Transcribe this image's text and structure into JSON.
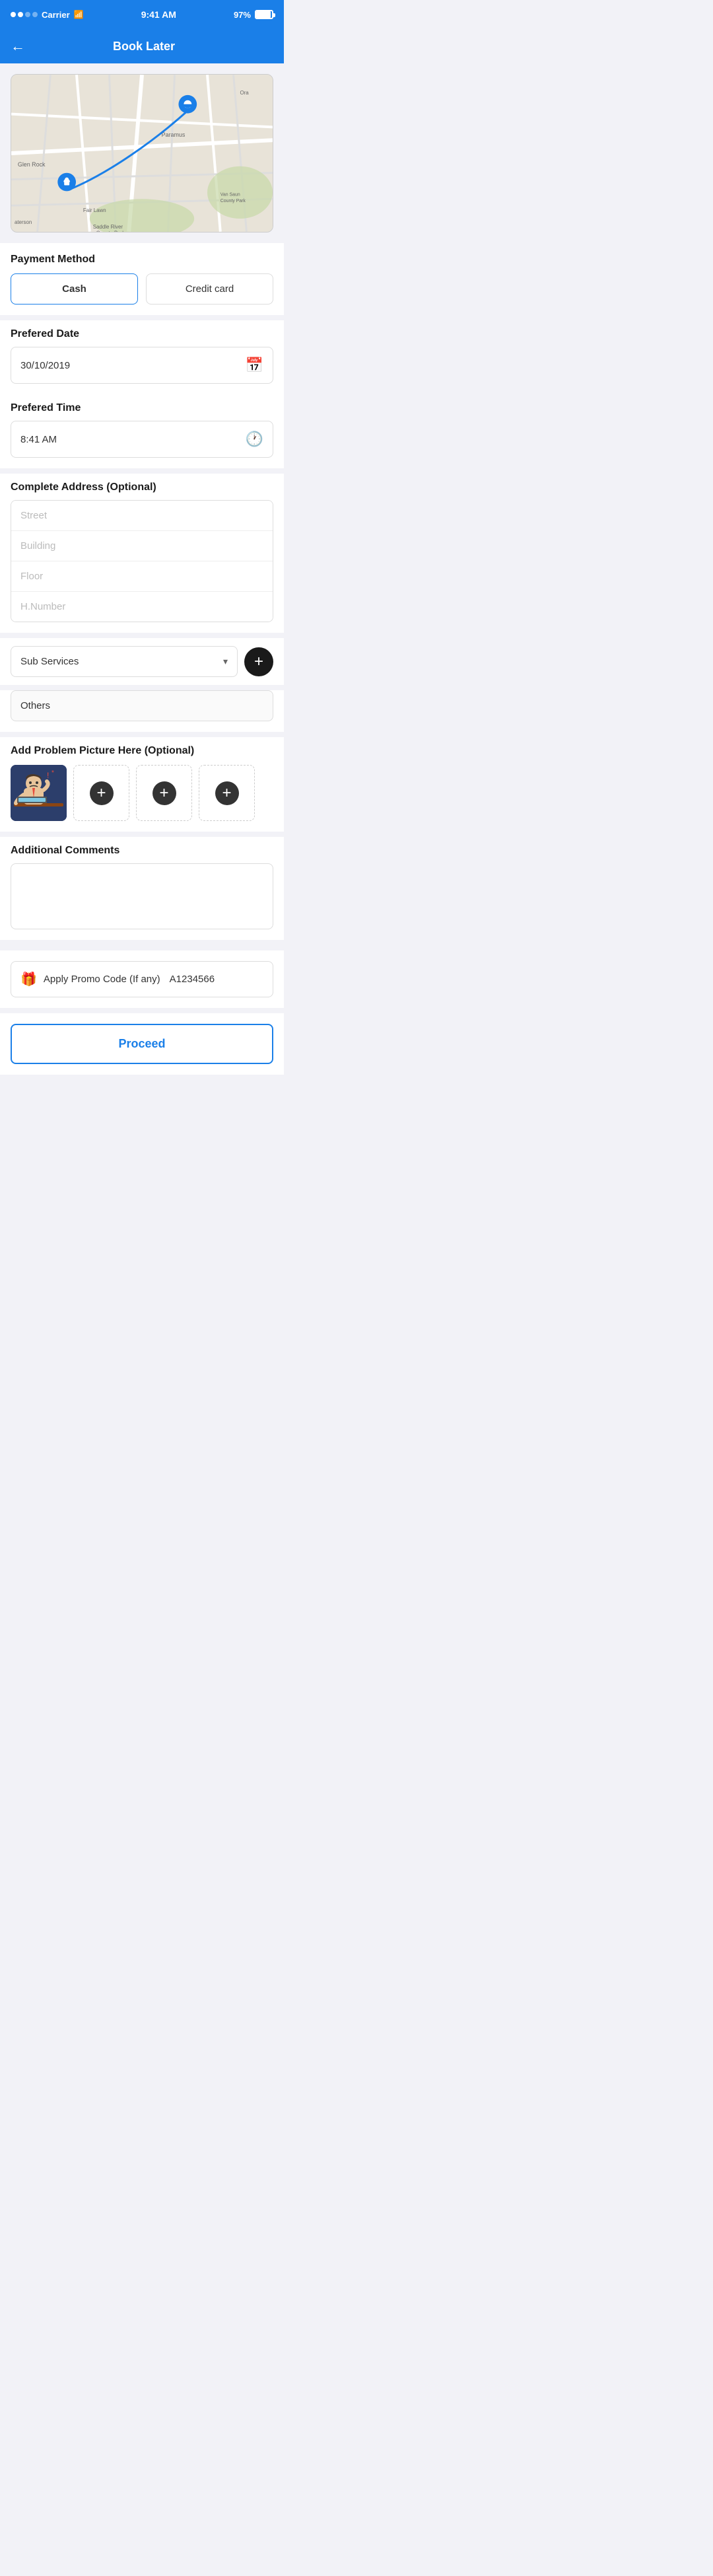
{
  "statusBar": {
    "carrier": "Carrier",
    "time": "9:41 AM",
    "battery": "97%"
  },
  "navBar": {
    "title": "Book Later",
    "backLabel": "←"
  },
  "paymentMethod": {
    "title": "Payment Method",
    "cash": "Cash",
    "creditCard": "Credit card"
  },
  "preferredDate": {
    "label": "Prefered Date",
    "value": "30/10/2019"
  },
  "preferredTime": {
    "label": "Prefered Time",
    "value": "8:41 AM"
  },
  "completeAddress": {
    "title": "Complete Address (Optional)",
    "street": "Street",
    "building": "Building",
    "floor": "Floor",
    "hNumber": "H.Number"
  },
  "subServices": {
    "label": "Sub Services"
  },
  "others": {
    "label": "Others"
  },
  "problemPicture": {
    "title": "Add Problem Picture Here (Optional)"
  },
  "additionalComments": {
    "title": "Additional Comments"
  },
  "promoCode": {
    "label": "Apply Promo Code (If any)",
    "value": "A1234566"
  },
  "proceed": {
    "label": "Proceed"
  }
}
